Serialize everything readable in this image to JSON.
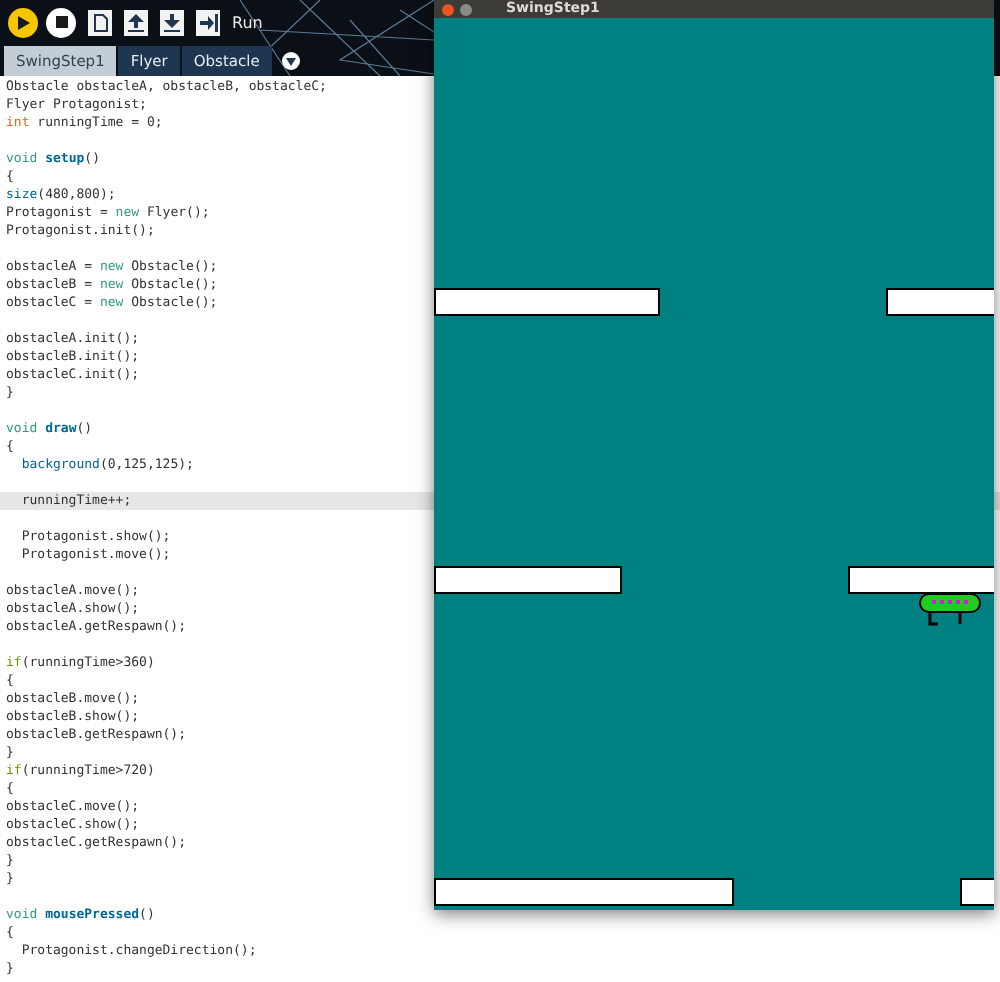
{
  "editor": {
    "toolbar": {
      "run_label": "Run"
    },
    "tabs": [
      {
        "label": "SwingStep1",
        "selected": true
      },
      {
        "label": "Flyer",
        "selected": false
      },
      {
        "label": "Obstacle",
        "selected": false
      }
    ],
    "code_lines": [
      {
        "current": false,
        "tokens": [
          {
            "text": "Obstacle obstacleA, obstacleB, obstacleC;",
            "kind": "plain"
          }
        ]
      },
      {
        "current": false,
        "tokens": [
          {
            "text": "Flyer Protagonist;",
            "kind": "plain"
          }
        ]
      },
      {
        "current": false,
        "tokens": [
          {
            "text": "int",
            "kind": "type"
          },
          {
            "text": " runningTime = 0;",
            "kind": "plain"
          }
        ]
      },
      {
        "current": false
      },
      {
        "current": false,
        "tokens": [
          {
            "text": "void ",
            "kind": "keyword"
          },
          {
            "text": "setup",
            "kind": "function_def"
          },
          {
            "text": "()",
            "kind": "plain"
          }
        ]
      },
      {
        "current": false,
        "tokens": [
          {
            "text": "{",
            "kind": "plain"
          }
        ]
      },
      {
        "current": false,
        "tokens": [
          {
            "text": "size",
            "kind": "builtin"
          },
          {
            "text": "(480,800);",
            "kind": "plain"
          }
        ]
      },
      {
        "current": false,
        "tokens": [
          {
            "text": "Protagonist = ",
            "kind": "plain"
          },
          {
            "text": "new",
            "kind": "keyword"
          },
          {
            "text": " Flyer();",
            "kind": "plain"
          }
        ]
      },
      {
        "current": false,
        "tokens": [
          {
            "text": "Protagonist.init();",
            "kind": "plain"
          }
        ]
      },
      {
        "current": false
      },
      {
        "current": false,
        "tokens": [
          {
            "text": "obstacleA = ",
            "kind": "plain"
          },
          {
            "text": "new",
            "kind": "keyword"
          },
          {
            "text": " Obstacle();",
            "kind": "plain"
          }
        ]
      },
      {
        "current": false,
        "tokens": [
          {
            "text": "obstacleB = ",
            "kind": "plain"
          },
          {
            "text": "new",
            "kind": "keyword"
          },
          {
            "text": " Obstacle();",
            "kind": "plain"
          }
        ]
      },
      {
        "current": false,
        "tokens": [
          {
            "text": "obstacleC = ",
            "kind": "plain"
          },
          {
            "text": "new",
            "kind": "keyword"
          },
          {
            "text": " Obstacle();",
            "kind": "plain"
          }
        ]
      },
      {
        "current": false
      },
      {
        "current": false,
        "tokens": [
          {
            "text": "obstacleA.init();",
            "kind": "plain"
          }
        ]
      },
      {
        "current": false,
        "tokens": [
          {
            "text": "obstacleB.init();",
            "kind": "plain"
          }
        ]
      },
      {
        "current": false,
        "tokens": [
          {
            "text": "obstacleC.init();",
            "kind": "plain"
          }
        ]
      },
      {
        "current": false,
        "tokens": [
          {
            "text": "}",
            "kind": "plain"
          }
        ]
      },
      {
        "current": false
      },
      {
        "current": false,
        "tokens": [
          {
            "text": "void ",
            "kind": "keyword"
          },
          {
            "text": "draw",
            "kind": "function_def"
          },
          {
            "text": "()",
            "kind": "plain"
          }
        ]
      },
      {
        "current": false,
        "tokens": [
          {
            "text": "{",
            "kind": "plain"
          }
        ]
      },
      {
        "current": false,
        "tokens": [
          {
            "text": "  background",
            "kind": "builtin"
          },
          {
            "text": "(0,125,125);",
            "kind": "plain"
          }
        ]
      },
      {
        "current": false
      },
      {
        "current": true,
        "tokens": [
          {
            "text": "  runningTime++;",
            "kind": "plain"
          }
        ]
      },
      {
        "current": false
      },
      {
        "current": false,
        "tokens": [
          {
            "text": "  Protagonist.show();",
            "kind": "plain"
          }
        ]
      },
      {
        "current": false,
        "tokens": [
          {
            "text": "  Protagonist.move();",
            "kind": "plain"
          }
        ]
      },
      {
        "current": false
      },
      {
        "current": false,
        "tokens": [
          {
            "text": "obstacleA.move();",
            "kind": "plain"
          }
        ]
      },
      {
        "current": false,
        "tokens": [
          {
            "text": "obstacleA.show();",
            "kind": "plain"
          }
        ]
      },
      {
        "current": false,
        "tokens": [
          {
            "text": "obstacleA.getRespawn();",
            "kind": "plain"
          }
        ]
      },
      {
        "current": false
      },
      {
        "current": false,
        "tokens": [
          {
            "text": "if",
            "kind": "control"
          },
          {
            "text": "(runningTime>360)",
            "kind": "plain"
          }
        ]
      },
      {
        "current": false,
        "tokens": [
          {
            "text": "{",
            "kind": "plain"
          }
        ]
      },
      {
        "current": false,
        "tokens": [
          {
            "text": "obstacleB.move();",
            "kind": "plain"
          }
        ]
      },
      {
        "current": false,
        "tokens": [
          {
            "text": "obstacleB.show();",
            "kind": "plain"
          }
        ]
      },
      {
        "current": false,
        "tokens": [
          {
            "text": "obstacleB.getRespawn();",
            "kind": "plain"
          }
        ]
      },
      {
        "current": false,
        "tokens": [
          {
            "text": "}",
            "kind": "plain"
          }
        ]
      },
      {
        "current": false,
        "tokens": [
          {
            "text": "if",
            "kind": "control"
          },
          {
            "text": "(runningTime>720)",
            "kind": "plain"
          }
        ]
      },
      {
        "current": false,
        "tokens": [
          {
            "text": "{",
            "kind": "plain"
          }
        ]
      },
      {
        "current": false,
        "tokens": [
          {
            "text": "obstacleC.move();",
            "kind": "plain"
          }
        ]
      },
      {
        "current": false,
        "tokens": [
          {
            "text": "obstacleC.show();",
            "kind": "plain"
          }
        ]
      },
      {
        "current": false,
        "tokens": [
          {
            "text": "obstacleC.getRespawn();",
            "kind": "plain"
          }
        ]
      },
      {
        "current": false,
        "tokens": [
          {
            "text": "}",
            "kind": "plain"
          }
        ]
      },
      {
        "current": false,
        "tokens": [
          {
            "text": "}",
            "kind": "plain"
          }
        ]
      },
      {
        "current": false
      },
      {
        "current": false,
        "tokens": [
          {
            "text": "void ",
            "kind": "keyword"
          },
          {
            "text": "mousePressed",
            "kind": "function_def"
          },
          {
            "text": "()",
            "kind": "plain"
          }
        ]
      },
      {
        "current": false,
        "tokens": [
          {
            "text": "{",
            "kind": "plain"
          }
        ]
      },
      {
        "current": false,
        "tokens": [
          {
            "text": "  Protagonist.changeDirection();",
            "kind": "plain"
          }
        ]
      },
      {
        "current": false,
        "tokens": [
          {
            "text": "}",
            "kind": "plain"
          }
        ]
      }
    ]
  },
  "sketch_window": {
    "title": "SwingStep1"
  }
}
